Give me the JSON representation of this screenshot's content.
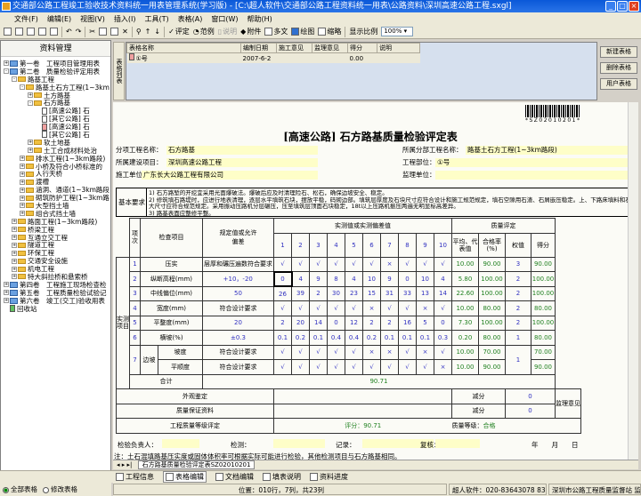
{
  "window": {
    "title": "交通部公路工程竣工验收技术资料统一用表管理系统(学习版) - [C:\\超人软件\\交通部公路工程资料统一用表\\公路资料\\深圳高速公路工程.sxgl]"
  },
  "menu": [
    "文件(F)",
    "编辑(E)",
    "视图(V)",
    "插入(I)",
    "工具(T)",
    "表格(A)",
    "窗口(W)",
    "帮助(H)"
  ],
  "toolbar": {
    "evaluate": "评定",
    "example": "范例",
    "explain": "说明",
    "attach": "附件",
    "multi": "多文",
    "draw": "绘图",
    "thumb": "缩略",
    "zoom_label": "显示比例",
    "zoom_value": "100%"
  },
  "left_panel": {
    "title": "资料管理",
    "tree": [
      {
        "d": 0,
        "i": "book",
        "e": "+",
        "t": "第一卷　工程项目管理用表"
      },
      {
        "d": 0,
        "i": "book",
        "e": "-",
        "t": "第二卷　质量检验评定用表"
      },
      {
        "d": 1,
        "i": "fold",
        "e": "-",
        "t": "路基工程"
      },
      {
        "d": 2,
        "i": "fold",
        "e": "-",
        "t": "路基土石方工程(1~3km"
      },
      {
        "d": 3,
        "i": "fold",
        "e": "+",
        "t": "土方路基"
      },
      {
        "d": 3,
        "i": "fold",
        "e": "-",
        "t": "石方路基"
      },
      {
        "d": 4,
        "i": "doc",
        "e": "",
        "t": "[高速公路] 石"
      },
      {
        "d": 4,
        "i": "doc",
        "e": "",
        "t": "[其它公路] 石"
      },
      {
        "d": 4,
        "i": "docr",
        "e": "",
        "t": "[高速公路] 石"
      },
      {
        "d": 4,
        "i": "doc",
        "e": "",
        "t": "[其它公路] 石"
      },
      {
        "d": 3,
        "i": "fold",
        "e": "+",
        "t": "软土地基"
      },
      {
        "d": 3,
        "i": "fold",
        "e": "+",
        "t": "土工合成材料处治"
      },
      {
        "d": 2,
        "i": "fold",
        "e": "+",
        "t": "排水工程(1~3km路段)"
      },
      {
        "d": 2,
        "i": "fold",
        "e": "+",
        "t": "小桥及符合小桥标准的"
      },
      {
        "d": 2,
        "i": "fold",
        "e": "+",
        "t": "人行天桥"
      },
      {
        "d": 2,
        "i": "fold",
        "e": "+",
        "t": "渡槽"
      },
      {
        "d": 2,
        "i": "fold",
        "e": "+",
        "t": "涵洞、通道(1~3km路段"
      },
      {
        "d": 2,
        "i": "fold",
        "e": "+",
        "t": "砌筑防护工程(1~3km路"
      },
      {
        "d": 2,
        "i": "fold",
        "e": "+",
        "t": "大型挡土墙"
      },
      {
        "d": 2,
        "i": "fold",
        "e": "+",
        "t": "组合式挡土墙"
      },
      {
        "d": 1,
        "i": "fold",
        "e": "+",
        "t": "路面工程(1~3km路段)"
      },
      {
        "d": 1,
        "i": "fold",
        "e": "+",
        "t": "桥梁工程"
      },
      {
        "d": 1,
        "i": "fold",
        "e": "+",
        "t": "互通立交工程"
      },
      {
        "d": 1,
        "i": "fold",
        "e": "+",
        "t": "隧道工程"
      },
      {
        "d": 1,
        "i": "fold",
        "e": "+",
        "t": "环保工程"
      },
      {
        "d": 1,
        "i": "fold",
        "e": "+",
        "t": "交通安全设施"
      },
      {
        "d": 1,
        "i": "fold",
        "e": "+",
        "t": "机电工程"
      },
      {
        "d": 1,
        "i": "fold",
        "e": "+",
        "t": "特大斜拉桥和悬索桥"
      },
      {
        "d": 0,
        "i": "book",
        "e": "+",
        "t": "第四卷　工程施工现场检查检"
      },
      {
        "d": 0,
        "i": "book",
        "e": "+",
        "t": "第五卷　工程质量检验试验记"
      },
      {
        "d": 0,
        "i": "book",
        "e": "+",
        "t": "第六卷　竣工(交工)验收用表"
      },
      {
        "d": 0,
        "i": "bin",
        "e": "",
        "t": "回收站"
      }
    ]
  },
  "table_list": {
    "tab": "表格列表",
    "headers": [
      "表格名称",
      "编制日期",
      "施工意见",
      "监理意见",
      "得分",
      "说明"
    ],
    "rows": [
      [
        "①号",
        "2007-6-2",
        "",
        "",
        "0.00",
        ""
      ]
    ],
    "buttons": {
      "new": "新建表格",
      "delete": "删除表格",
      "user": "用户表格"
    }
  },
  "document": {
    "barcode": "*SZ02010201*",
    "title": "[高速公路] 石方路基质量检验评定表",
    "fields": {
      "sub_label": "分项工程名称：",
      "sub_value": "石方路基",
      "proj_label": "所属建设项目：",
      "proj_value": "深圳高速公路工程",
      "unit_label": "施工单位：",
      "unit_value": "广东长大公路工程有限公司",
      "div_label": "所属分部工程名称：",
      "div_value": "路基土石方工程(1~3km路段)",
      "part_label": "工程部位：",
      "part_value": "①号",
      "sup_label": "监理单位：",
      "sup_value": ""
    },
    "requirements": {
      "label": "基本要求",
      "text": "1) 石方路堑的开挖宜采用光面爆破法。爆破后应及时清理险石、松石，确保边坡安全、稳定。\n2) 修筑填石路堤时，应进行地表清理，逐层水平填筑石块，摆放平稳，码砌边部。填筑层厚度及石块尺寸应符合设计和施工规范规定，填石空隙用石渣、石屑嵌压稳定。上、下路床填料和石料最大尺寸应符合规范规定。采用振动压路机分层碾压，压至填筑层顶面石块稳定，18t以上压路机振压两遍无明显标高差异。\n3) 路基表面应整修平整。"
    },
    "table": {
      "h_section": "实测项目",
      "h_no": "项次",
      "h_item": "检查项目",
      "h_spec": "规定值或允许偏差",
      "h_measured": "实测值或实测偏差值",
      "h_eval": "质量评定",
      "h_avg": "平均、代表值",
      "h_rate": "合格率(%)",
      "h_weight": "权值",
      "h_score": "得分",
      "cols": [
        "1",
        "2",
        "3",
        "4",
        "5",
        "6",
        "7",
        "8",
        "9",
        "10"
      ],
      "rows": [
        {
          "no": "1",
          "item": "压实",
          "spec": "层厚和碾压遍数符合要求",
          "vals": [
            "√",
            "√",
            "√",
            "√",
            "√",
            "√",
            "×",
            "√",
            "√",
            "√"
          ],
          "avg": "10.00",
          "rate": "90.00",
          "weight": "3",
          "score": "90.00"
        },
        {
          "no": "2",
          "item": "纵断高程(mm)",
          "spec": "+10，-20",
          "vals": [
            "0",
            "4",
            "9",
            "8",
            "4",
            "10",
            "9",
            "0",
            "10",
            "4"
          ],
          "avg": "5.80",
          "rate": "100.00",
          "weight": "2",
          "score": "100.00"
        },
        {
          "no": "3",
          "item": "中线偏位(mm)",
          "spec": "50",
          "vals": [
            "26",
            "39",
            "2",
            "30",
            "23",
            "15",
            "31",
            "33",
            "13",
            "14"
          ],
          "avg": "22.60",
          "rate": "100.00",
          "weight": "2",
          "score": "100.00"
        },
        {
          "no": "4",
          "item": "宽度(mm)",
          "spec": "符合设计要求",
          "vals": [
            "√",
            "√",
            "√",
            "√",
            "√",
            "×",
            "√",
            "√",
            "×",
            "√"
          ],
          "avg": "10.00",
          "rate": "80.00",
          "weight": "2",
          "score": "80.00"
        },
        {
          "no": "5",
          "item": "平整度(mm)",
          "spec": "20",
          "vals": [
            "2",
            "20",
            "14",
            "0",
            "12",
            "2",
            "2",
            "16",
            "5",
            "0"
          ],
          "avg": "7.30",
          "rate": "100.00",
          "weight": "2",
          "score": "100.00"
        },
        {
          "no": "6",
          "item": "横坡(%)",
          "spec": "±0.3",
          "vals": [
            "0.1",
            "0.2",
            "0.1",
            "0.4",
            "0.4",
            "0.2",
            "0.1",
            "0.1",
            "0.1",
            "0.3"
          ],
          "avg": "0.20",
          "rate": "80.00",
          "weight": "1",
          "score": "80.00"
        }
      ],
      "slope": {
        "no": "7",
        "item": "边坡",
        "weight": "1",
        "subs": [
          {
            "item": "坡度",
            "spec": "符合设计要求",
            "vals": [
              "√",
              "√",
              "√",
              "√",
              "√",
              "×",
              "×",
              "√",
              "×",
              "√"
            ],
            "avg": "10.00",
            "rate": "70.00",
            "score": "70.00"
          },
          {
            "item": "平顺度",
            "spec": "符合设计要求",
            "vals": [
              "√",
              "√",
              "√",
              "√",
              "√",
              "√",
              "√",
              "√",
              "√",
              "×"
            ],
            "avg": "10.00",
            "rate": "90.00",
            "score": "90.00"
          }
        ]
      },
      "total_label": "合计",
      "total": "90.71",
      "appearance_label": "外观鉴定",
      "deduct_label": "减分",
      "appearance_deduct": "0",
      "assurance_label": "质量保证资料",
      "assurance_deduct": "0",
      "supervisor_label": "监理意见",
      "grade_label": "工程质量等级评定",
      "score_text": "评分：90.71",
      "grade_text_label": "质量等级：",
      "grade": "合格"
    },
    "signatures": {
      "inspector": "检验负责人：",
      "tester": "检测：",
      "recorder": "记录：",
      "reviewer": "复核：",
      "date": "年　　月　　日"
    },
    "note": "注：土石混填路基压实度或固体体积率可根据实际可能进行检验，其他检测项目与石方路基相同。"
  },
  "sheet_tab": "石方路基质量检验评定表SZ02010201",
  "bottom_tabs": [
    "工程信息",
    "表格编辑",
    "文档编辑",
    "填表说明",
    "资料进度"
  ],
  "filter": {
    "all": "全部表格",
    "modified": "修改表格"
  },
  "status": {
    "position": "位置：010行，7列，共23列",
    "phone": "超人软件：020-83643078 83643083",
    "org": "深圳市公路工程质量监督站 监制"
  }
}
